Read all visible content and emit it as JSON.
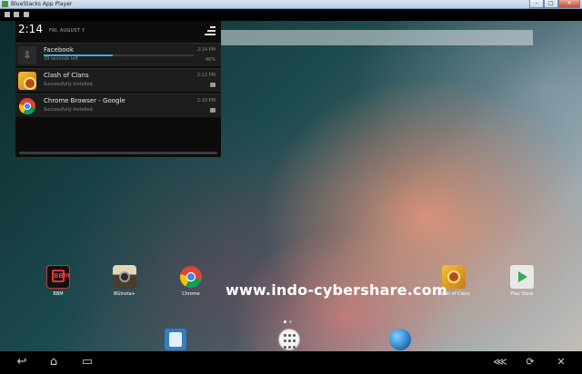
{
  "window": {
    "title": "BlueStacks App Player",
    "minimize": "–",
    "maximize": "□",
    "close": "✕"
  },
  "notification_shade": {
    "time": "2:14",
    "date": "FRI, AUGUST 7",
    "notifications": [
      {
        "app": "Facebook",
        "subtitle": "39 seconds left",
        "time": "2:14 PM",
        "percent": "46%",
        "progress": 0.46,
        "icon": "download-icon"
      },
      {
        "app": "Clash of Clans",
        "subtitle": "Successfully installed.",
        "time": "2:12 PM",
        "icon": "clash-of-clans-icon"
      },
      {
        "app": "Chrome Browser - Google",
        "subtitle": "Successfully installed.",
        "time": "2:10 PM",
        "icon": "chrome-icon"
      }
    ]
  },
  "home_apps": [
    {
      "label": "BBM",
      "icon": "bbm-icon"
    },
    {
      "label": "BGInsta+",
      "icon": "instagram-icon"
    },
    {
      "label": "Chrome",
      "icon": "chrome-icon"
    },
    {
      "label": "Clash of Clans",
      "icon": "clash-of-clans-icon"
    },
    {
      "label": "Play Store",
      "icon": "play-store-icon"
    }
  ],
  "watermark": "www.indo-cybershare.com",
  "dock": [
    {
      "icon": "contacts-icon"
    },
    {
      "icon": "all-apps-icon"
    },
    {
      "icon": "browser-icon"
    }
  ],
  "navbar": {
    "back": "↩",
    "home": "⌂",
    "recent": "▭",
    "share": "⋘",
    "rotate": "⟳",
    "close": "✕"
  },
  "colors": {
    "accent": "#33b5e5",
    "shade_bg": "#0c0c0c",
    "notification_bg": "#1d1d1d"
  }
}
